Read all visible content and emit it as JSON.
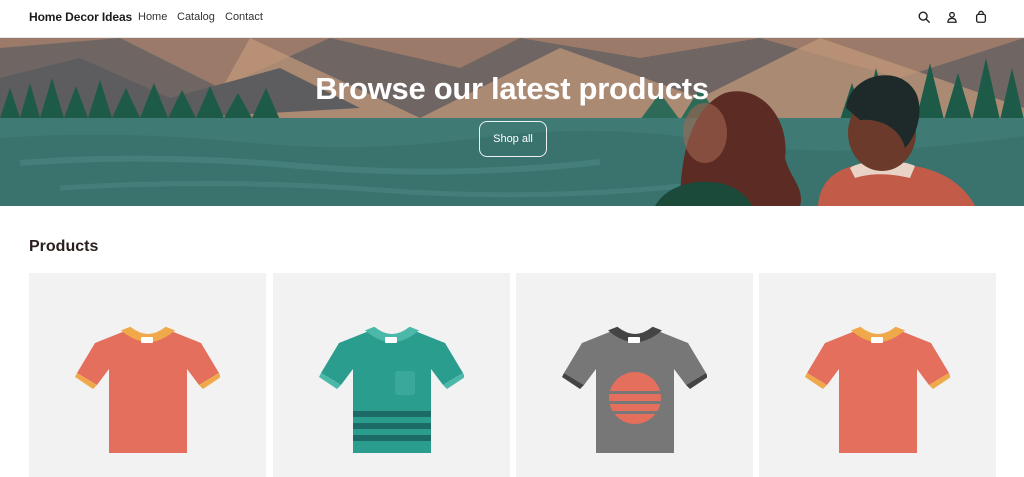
{
  "header": {
    "brand": "Home Decor Ideas",
    "nav": [
      "Home",
      "Catalog",
      "Contact"
    ],
    "icons": [
      "search-icon",
      "account-icon",
      "cart-icon"
    ]
  },
  "hero": {
    "title": "Browse our latest products",
    "button_label": "Shop all"
  },
  "products": {
    "title": "Products",
    "items": [
      {
        "shirt_color": "#e36f5c",
        "collar_color": "#f0a94a",
        "style": "plain"
      },
      {
        "shirt_color": "#2a9d8f",
        "collar_color": "#4cb8aa",
        "style": "pocket-stripes"
      },
      {
        "shirt_color": "#777777",
        "collar_color": "#444444",
        "style": "sunset"
      },
      {
        "shirt_color": "#e36f5c",
        "collar_color": "#f0a94a",
        "style": "plain"
      }
    ]
  },
  "colors": {
    "accent_text": "#2a1f1d",
    "card_bg": "#f2f2f2",
    "hero_water": "#3f7a75"
  }
}
